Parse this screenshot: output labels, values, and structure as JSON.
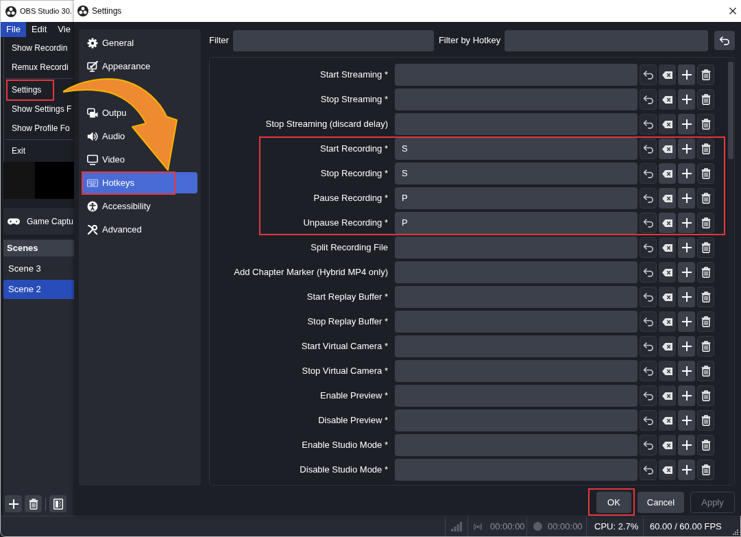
{
  "main_window": {
    "title": "OBS Studio 30.",
    "menu_bar": [
      {
        "label": "File",
        "selected": true
      },
      {
        "label": "Edit",
        "selected": false
      },
      {
        "label": "Vie",
        "selected": false
      }
    ],
    "file_menu": [
      {
        "kind": "item",
        "label": "Show Recordin",
        "highlighted": false
      },
      {
        "kind": "item",
        "label": "Remux Recordi",
        "highlighted": false
      },
      {
        "kind": "separator"
      },
      {
        "kind": "item",
        "label": "Settings",
        "highlighted": true
      },
      {
        "kind": "item",
        "label": "Show Settings F",
        "highlighted": false
      },
      {
        "kind": "item",
        "label": "Show Profile Fo",
        "highlighted": false
      },
      {
        "kind": "separator"
      },
      {
        "kind": "item",
        "label": "Exit",
        "highlighted": false
      }
    ],
    "source": {
      "label": "Game Captu"
    },
    "scenes": {
      "title": "Scenes",
      "items": [
        {
          "label": "Scene 3",
          "selected": false
        },
        {
          "label": "Scene 2",
          "selected": true
        }
      ]
    },
    "status_bar": {
      "stream_time": "00:00:00",
      "record_time": "00:00:00",
      "cpu": "CPU: 2.7%",
      "fps": "60.00 / 60.00 FPS"
    }
  },
  "settings": {
    "title": "Settings",
    "sidebar": [
      {
        "kind": "page",
        "label": "General",
        "selected": false,
        "highlighted": false
      },
      {
        "kind": "page",
        "label": "Appearance",
        "selected": false,
        "highlighted": false
      },
      {
        "kind": "covered"
      },
      {
        "kind": "page",
        "label": "Outpu",
        "selected": false,
        "highlighted": false
      },
      {
        "kind": "page",
        "label": "Audio",
        "selected": false,
        "highlighted": false
      },
      {
        "kind": "page",
        "label": "Video",
        "selected": false,
        "highlighted": false
      },
      {
        "kind": "page",
        "label": "Hotkeys",
        "selected": true,
        "highlighted": true
      },
      {
        "kind": "page",
        "label": "Accessibility",
        "selected": false,
        "highlighted": false
      },
      {
        "kind": "page",
        "label": "Advanced",
        "selected": false,
        "highlighted": false
      }
    ],
    "filter": {
      "label": "Filter"
    },
    "filter_by_hotkey": {
      "label": "Filter by Hotkey"
    },
    "hotkeys": [
      {
        "action": "Start Streaming *",
        "highlighted": false
      },
      {
        "action": "Stop Streaming *",
        "highlighted": false
      },
      {
        "action": "Stop Streaming (discard delay)",
        "highlighted": false
      },
      {
        "action": "Start Recording *",
        "key": "S",
        "highlighted": true
      },
      {
        "action": "Stop Recording *",
        "key": "S",
        "highlighted": true
      },
      {
        "action": "Pause Recording *",
        "key": "P",
        "highlighted": true
      },
      {
        "action": "Unpause Recording *",
        "key": "P",
        "highlighted": true
      },
      {
        "action": "Split Recording File",
        "highlighted": false
      },
      {
        "action": "Add Chapter Marker (Hybrid MP4 only)",
        "highlighted": false
      },
      {
        "action": "Start Replay Buffer *",
        "highlighted": false
      },
      {
        "action": "Stop Replay Buffer *",
        "highlighted": false
      },
      {
        "action": "Start Virtual Camera *",
        "highlighted": false
      },
      {
        "action": "Stop Virtual Camera *",
        "highlighted": false
      },
      {
        "action": "Enable Preview *",
        "highlighted": false
      },
      {
        "action": "Disable Preview *",
        "highlighted": false
      },
      {
        "action": "Enable Studio Mode *",
        "highlighted": false
      },
      {
        "action": "Disable Studio Mode *",
        "highlighted": false
      }
    ],
    "buttons": [
      {
        "label": "OK",
        "disabled": false,
        "highlighted": true
      },
      {
        "label": "Cancel",
        "disabled": false,
        "highlighted": false
      },
      {
        "label": "Apply",
        "disabled": true,
        "highlighted": false
      }
    ]
  }
}
